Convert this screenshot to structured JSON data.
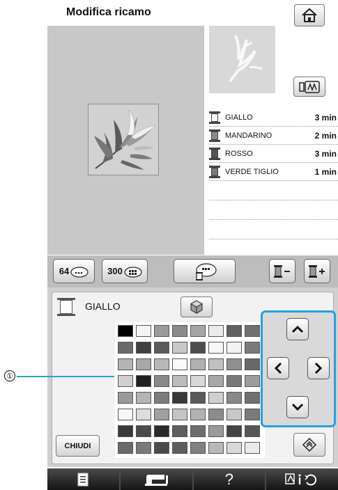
{
  "header": {
    "title": "Modifica ricamo"
  },
  "colors": {
    "accent": "#28a0dc",
    "background_area": "#c8c8c8"
  },
  "color_list": [
    {
      "name": "GIALLO",
      "time": "3 min"
    },
    {
      "name": "MANDARINO",
      "time": "2 min"
    },
    {
      "name": "ROSSO",
      "time": "3 min"
    },
    {
      "name": "VERDE TIGLIO",
      "time": "1 min"
    }
  ],
  "toolbar": {
    "palette64_label": "64",
    "palette300_label": "300"
  },
  "selected_color": {
    "name": "GIALLO"
  },
  "buttons": {
    "close_label": "CHIUDI"
  },
  "callout": {
    "number": "①"
  },
  "icons": {
    "home": "home-icon",
    "frame": "frame-icon",
    "cube": "cube-icon",
    "rotate": "rotate-icon",
    "up": "arrow-up-icon",
    "down": "arrow-down-icon",
    "left": "arrow-left-icon",
    "right": "arrow-right-icon"
  },
  "palette_rows": [
    [
      "#000000",
      "#f4f4f4",
      "#9a9a9a",
      "#8a8a8a",
      "#a6a6a6",
      "#ececec",
      "#606060",
      "#707070"
    ],
    [
      "#6a6a6a",
      "#404040",
      "#5a5a5a",
      "#c8c8c8",
      "#4c4c4c",
      "#f6f6f6",
      "#f2f2f2",
      "#7a7a7a"
    ],
    [
      "#b4b4b4",
      "#a8a8a8",
      "#b8b8b8",
      "#fafafa",
      "#b0b0b0",
      "#c0c0c0",
      "#909090",
      "#686868"
    ],
    [
      "#d0d0d0",
      "#202020",
      "#8a8a8a",
      "#bcbcbc",
      "#d8d8d8",
      "#a8a8a8",
      "#787878",
      "#9c9c9c"
    ],
    [
      "#9a9a9a",
      "#b4b4b4",
      "#7c7c7c",
      "#383838",
      "#5a5a5a",
      "#cfcfcf",
      "#888888",
      "#707070"
    ],
    [
      "#f6f6f6",
      "#dcdcdc",
      "#a0a0a0",
      "#c4c4c4",
      "#b2b2b2",
      "#8c8c8c",
      "#c8c8c8",
      "#7a7a7a"
    ],
    [
      "#3a3a3a",
      "#4a4a4a",
      "#2a2a2a",
      "#5e5e5e",
      "#6e6e6e",
      "#9a9a9a",
      "#444444",
      "#565656"
    ],
    [
      "#6a6a6a",
      "#7a7a7a",
      "#4a4a4a",
      "#5c5c5c",
      "#808080",
      "#b8b8b8",
      "#d8d8d8",
      "#eaeaea"
    ]
  ]
}
